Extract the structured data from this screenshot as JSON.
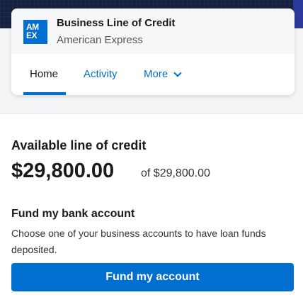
{
  "colors": {
    "banner": "#16213f",
    "brand_blue": "#006fcf",
    "amex_blue": "#016fd0",
    "page_gray": "#f3f5f7"
  },
  "account_card": {
    "logo_icon": "amex-logo-icon",
    "logo_line1": "AM",
    "logo_line2": "EX",
    "title": "Business Line of Credit",
    "subtitle": "American Express"
  },
  "tabs": [
    {
      "label": "Home",
      "active": true
    },
    {
      "label": "Activity",
      "active": false
    },
    {
      "label": "More",
      "active": false,
      "icon": "chevron-down-icon"
    }
  ],
  "credit": {
    "title": "Available line of credit",
    "amount": "$29,800.00",
    "of_total": "of $29,800.00"
  },
  "fund": {
    "title": "Fund my bank account",
    "description": "Choose one of your business accounts to have loan funds deposited.",
    "button_label": "Fund my account"
  }
}
